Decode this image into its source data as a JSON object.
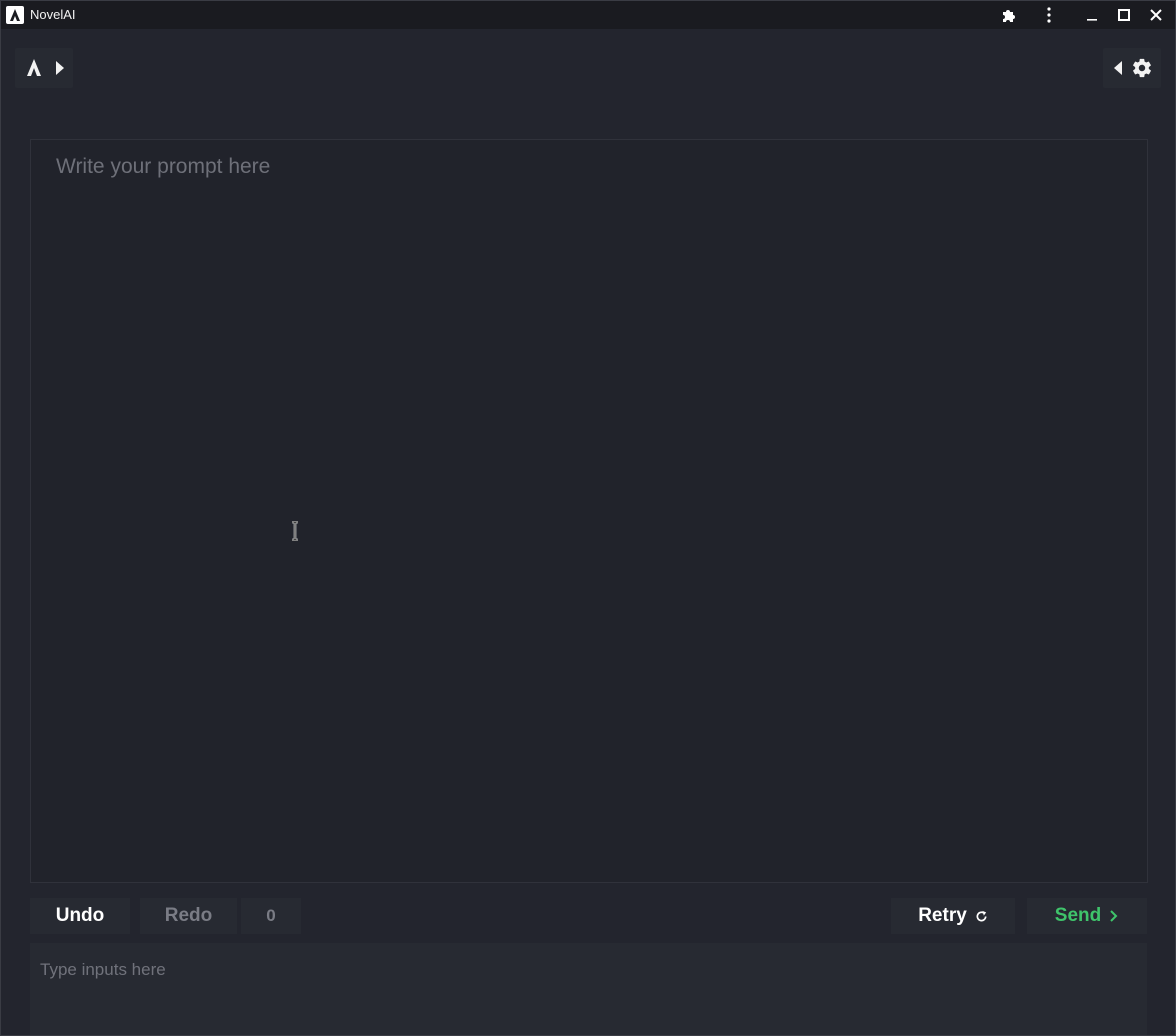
{
  "window": {
    "title": "NovelAI",
    "icons": [
      "novelai-logo-icon",
      "puzzle-icon",
      "kebab-menu-icon",
      "minimize-icon",
      "maximize-icon",
      "close-icon"
    ]
  },
  "toolbar": {
    "left_icons": [
      "novelai-logo-icon",
      "caret-right-icon"
    ],
    "right_icons": [
      "caret-left-icon",
      "gear-icon"
    ]
  },
  "prompt": {
    "placeholder": "Write your prompt here"
  },
  "actions": {
    "undo_label": "Undo",
    "redo_label": "Redo",
    "counter": "0",
    "retry_label": "Retry",
    "send_label": "Send"
  },
  "input": {
    "placeholder": "Type inputs here"
  },
  "colors": {
    "background": "#23252e",
    "titlebar": "#1a1b20",
    "send_accent": "#3fc46b",
    "muted_text": "#7a7c85"
  }
}
